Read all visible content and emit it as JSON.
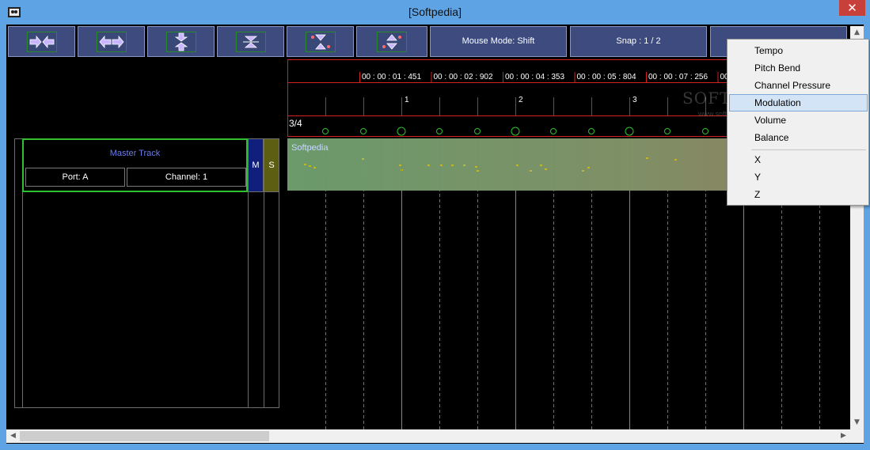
{
  "window": {
    "title": "[Softpedia]",
    "close_glyph": "✕"
  },
  "toolbar": {
    "icon_buttons": [
      {
        "name": "zoom-in-horizontal-icon"
      },
      {
        "name": "zoom-out-horizontal-icon"
      },
      {
        "name": "zoom-in-vertical-icon"
      },
      {
        "name": "zoom-out-vertical-icon"
      },
      {
        "name": "zoom-in-all-icon"
      },
      {
        "name": "zoom-out-all-icon"
      }
    ],
    "mouse_mode_label": "Mouse Mode: Shift",
    "snap_label": "Snap : 1 / 2",
    "extra_label": ""
  },
  "timeline": {
    "timestamps": [
      "00 : 00 : 01 : 451",
      "00 : 00 : 02 : 902",
      "00 : 00 : 04 : 353",
      "00 : 00 : 05 : 804",
      "00 : 00 : 07 : 256",
      "00"
    ],
    "measure_numbers": [
      "1",
      "2",
      "3"
    ],
    "time_signature": "3/4",
    "track_clip_name": "Softpedia",
    "accent_color": "#2fbf2f",
    "ruler_color": "#d02020"
  },
  "track": {
    "name": "Master Track",
    "port": "Port: A",
    "channel": "Channel: 1",
    "mute_label": "M",
    "solo_label": "S"
  },
  "context_menu": {
    "items": [
      "Tempo",
      "Pitch Bend",
      "Channel Pressure",
      "Modulation",
      "Volume",
      "Balance",
      "X",
      "Y",
      "Z"
    ],
    "highlighted": "Modulation"
  },
  "scrollbars": {
    "up_arrow": "▲",
    "down_arrow": "▼",
    "left_arrow": "◀",
    "right_arrow": "▶"
  },
  "watermark": {
    "text": "SOFTPEDIA",
    "sub": "www.softpedia.com"
  }
}
